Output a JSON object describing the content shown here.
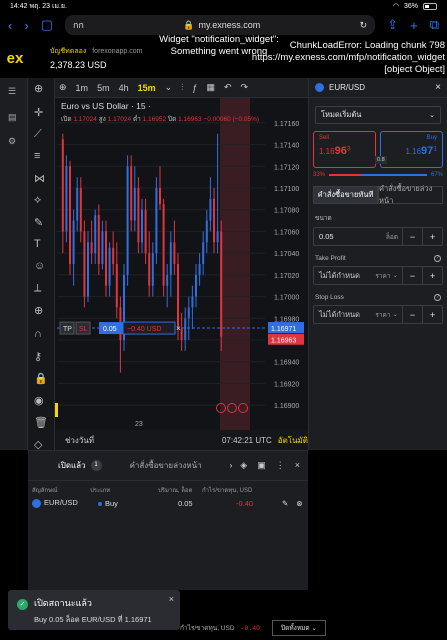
{
  "status_bar": {
    "time": "14:42",
    "date": "พฤ. 23 เม.ย.",
    "battery": "36%"
  },
  "browser": {
    "tab_label": "กก",
    "host": "my.exness.com",
    "reader_icon": "reader-icon"
  },
  "app": {
    "logo": "ex",
    "account_type": "บัญชีทดลอง",
    "account_source": "forexonapp.com",
    "balance": "2,378.23 USD",
    "error_widget": "Widget \"notification_widget\": Something went wrong",
    "error_chunk": "ChunkLoadError: Loading chunk 798 https://my.exness.com/mfp/notification_widget [object Object]"
  },
  "chart_header": {
    "timeframes": [
      "1m",
      "5m",
      "4h",
      "15m"
    ],
    "selected": "15m"
  },
  "chart_data": {
    "type": "candlestick",
    "title": "Euro vs US Dollar · 15 ·",
    "ohlc_label": {
      "open_lbl": "เปิด",
      "open": "1.17024",
      "high_lbl": "สูง",
      "high": "1.17024",
      "low_lbl": "ต่ำ",
      "low": "1.16952",
      "close_lbl": "ปิด",
      "close": "1.16963",
      "change": "−0.00060 (−0.05%)"
    },
    "y_ticks": [
      "1.17160",
      "1.17140",
      "1.17120",
      "1.17100",
      "1.17080",
      "1.17060",
      "1.17040",
      "1.17020",
      "1.17000",
      "1.16980",
      "1.16960",
      "1.16940",
      "1.16920",
      "1.16900"
    ],
    "ylim": [
      1.1689,
      1.1717
    ],
    "x_ticks": [
      "23"
    ],
    "candles": [
      [
        1.17145,
        1.1715,
        1.1704,
        1.1706
      ],
      [
        1.1706,
        1.1713,
        1.1705,
        1.1712
      ],
      [
        1.1712,
        1.17125,
        1.1702,
        1.1703
      ],
      [
        1.1703,
        1.1708,
        1.1701,
        1.1707
      ],
      [
        1.1707,
        1.1711,
        1.1706,
        1.171
      ],
      [
        1.171,
        1.1711,
        1.1705,
        1.1706
      ],
      [
        1.1706,
        1.1707,
        1.1699,
        1.17
      ],
      [
        1.17,
        1.1706,
        1.16995,
        1.1705
      ],
      [
        1.1705,
        1.1707,
        1.1703,
        1.1704
      ],
      [
        1.1704,
        1.1708,
        1.1703,
        1.17075
      ],
      [
        1.17075,
        1.17085,
        1.1702,
        1.1703
      ],
      [
        1.1703,
        1.1707,
        1.17025,
        1.1706
      ],
      [
        1.1706,
        1.1707,
        1.17,
        1.1701
      ],
      [
        1.1701,
        1.1705,
        1.17,
        1.17045
      ],
      [
        1.17045,
        1.1706,
        1.1702,
        1.1703
      ],
      [
        1.1703,
        1.1705,
        1.1698,
        1.1699
      ],
      [
        1.1699,
        1.17,
        1.1693,
        1.1696
      ],
      [
        1.1696,
        1.1703,
        1.1695,
        1.1702
      ],
      [
        1.1702,
        1.1713,
        1.1701,
        1.1712
      ],
      [
        1.1712,
        1.1713,
        1.1706,
        1.1707
      ],
      [
        1.1707,
        1.1712,
        1.1706,
        1.171
      ],
      [
        1.171,
        1.1711,
        1.1704,
        1.1705
      ],
      [
        1.1705,
        1.1709,
        1.1704,
        1.1708
      ],
      [
        1.1708,
        1.1709,
        1.1703,
        1.1704
      ],
      [
        1.1704,
        1.1706,
        1.17,
        1.1701
      ],
      [
        1.1701,
        1.1705,
        1.17,
        1.1704
      ],
      [
        1.1704,
        1.1711,
        1.1703,
        1.171
      ],
      [
        1.171,
        1.1712,
        1.1708,
        1.17085
      ],
      [
        1.17085,
        1.1709,
        1.17,
        1.1701
      ],
      [
        1.1701,
        1.1703,
        1.1699,
        1.1702
      ],
      [
        1.1702,
        1.1706,
        1.17,
        1.1705
      ],
      [
        1.1705,
        1.1707,
        1.1702,
        1.1703
      ],
      [
        1.1703,
        1.1704,
        1.1696,
        1.1697
      ],
      [
        1.1697,
        1.16985,
        1.1695,
        1.1696
      ],
      [
        1.1696,
        1.1699,
        1.1695,
        1.1698
      ],
      [
        1.1698,
        1.17,
        1.1696,
        1.1699
      ],
      [
        1.1699,
        1.1701,
        1.1697,
        1.17
      ],
      [
        1.17,
        1.1703,
        1.1699,
        1.1702
      ],
      [
        1.1702,
        1.1704,
        1.1701,
        1.1703
      ],
      [
        1.1703,
        1.1706,
        1.1702,
        1.1705
      ],
      [
        1.1705,
        1.1708,
        1.1704,
        1.1707
      ],
      [
        1.1707,
        1.1711,
        1.1706,
        1.1709
      ],
      [
        1.1709,
        1.171,
        1.1704,
        1.1705
      ],
      [
        1.1705,
        1.1715,
        1.1704,
        1.1706
      ],
      [
        1.1706,
        1.1707,
        1.1695,
        1.16963
      ]
    ],
    "position_line": {
      "price": 1.16971,
      "tp": "TP",
      "sl": "SL",
      "lots": "0.05",
      "pl": "−0.40 USD"
    },
    "bid_label": "1.16963",
    "ask_label": "1.16971",
    "event_badges": [
      "event-badge-icon",
      "event-badge-icon",
      "event-badge-icon"
    ]
  },
  "chart_footer": {
    "range": "ช่วงวันที่",
    "time": "07:42:21 UTC",
    "auto": "อัตโนมัติ"
  },
  "order_panel": {
    "symbol": "EUR/USD",
    "mode": "โหมดเริ่มต้น",
    "sell_label": "Sell",
    "sell_price_prefix": "1.16",
    "sell_price_big": "96",
    "sell_price_small": "3",
    "buy_label": "Buy",
    "buy_price_prefix": "1.16",
    "buy_price_big": "97",
    "buy_price_small": "1",
    "spread": "0.8",
    "sell_pct": "33%",
    "buy_pct": "67%",
    "sell_ratio": 0.33,
    "tabs": [
      "คำสั่งซื้อขายทันที",
      "คำสั่งซื้อขายล่วงหน้า"
    ],
    "volume_label": "ขนาด",
    "volume": "0.05",
    "volume_unit": "ล็อต",
    "tp_label": "Take Profit",
    "tp_value": "ไม่ได้กำหนด",
    "tp_unit": "ราคา",
    "sl_label": "Stop Loss",
    "sl_value": "ไม่ได้กำหนด",
    "sl_unit": "ราคา"
  },
  "positions": {
    "tab_open": "เปิดแล้ว",
    "tab_open_count": "1",
    "tab_pending": "คำสั่งซื้อขายล่วงหน้า",
    "headers": [
      "สัญลักษณ์",
      "ประเภท",
      "ปริมาณ, ล็อต",
      "กำไร/ขาดทุน, USD"
    ],
    "rows": [
      {
        "symbol": "EUR/USD",
        "type": "Buy",
        "volume": "0.05",
        "pl": "-0.40"
      }
    ]
  },
  "toast": {
    "title": "เปิดสถานะแล้ว",
    "message": "Buy 0.05 ล็อต EUR/USD ที่ 1.16971"
  },
  "footer": {
    "pl_label": "กำไร/ขาดทุน, USD",
    "pl_value": "-0.40",
    "close_all": "ปิดทั้งหมด"
  }
}
